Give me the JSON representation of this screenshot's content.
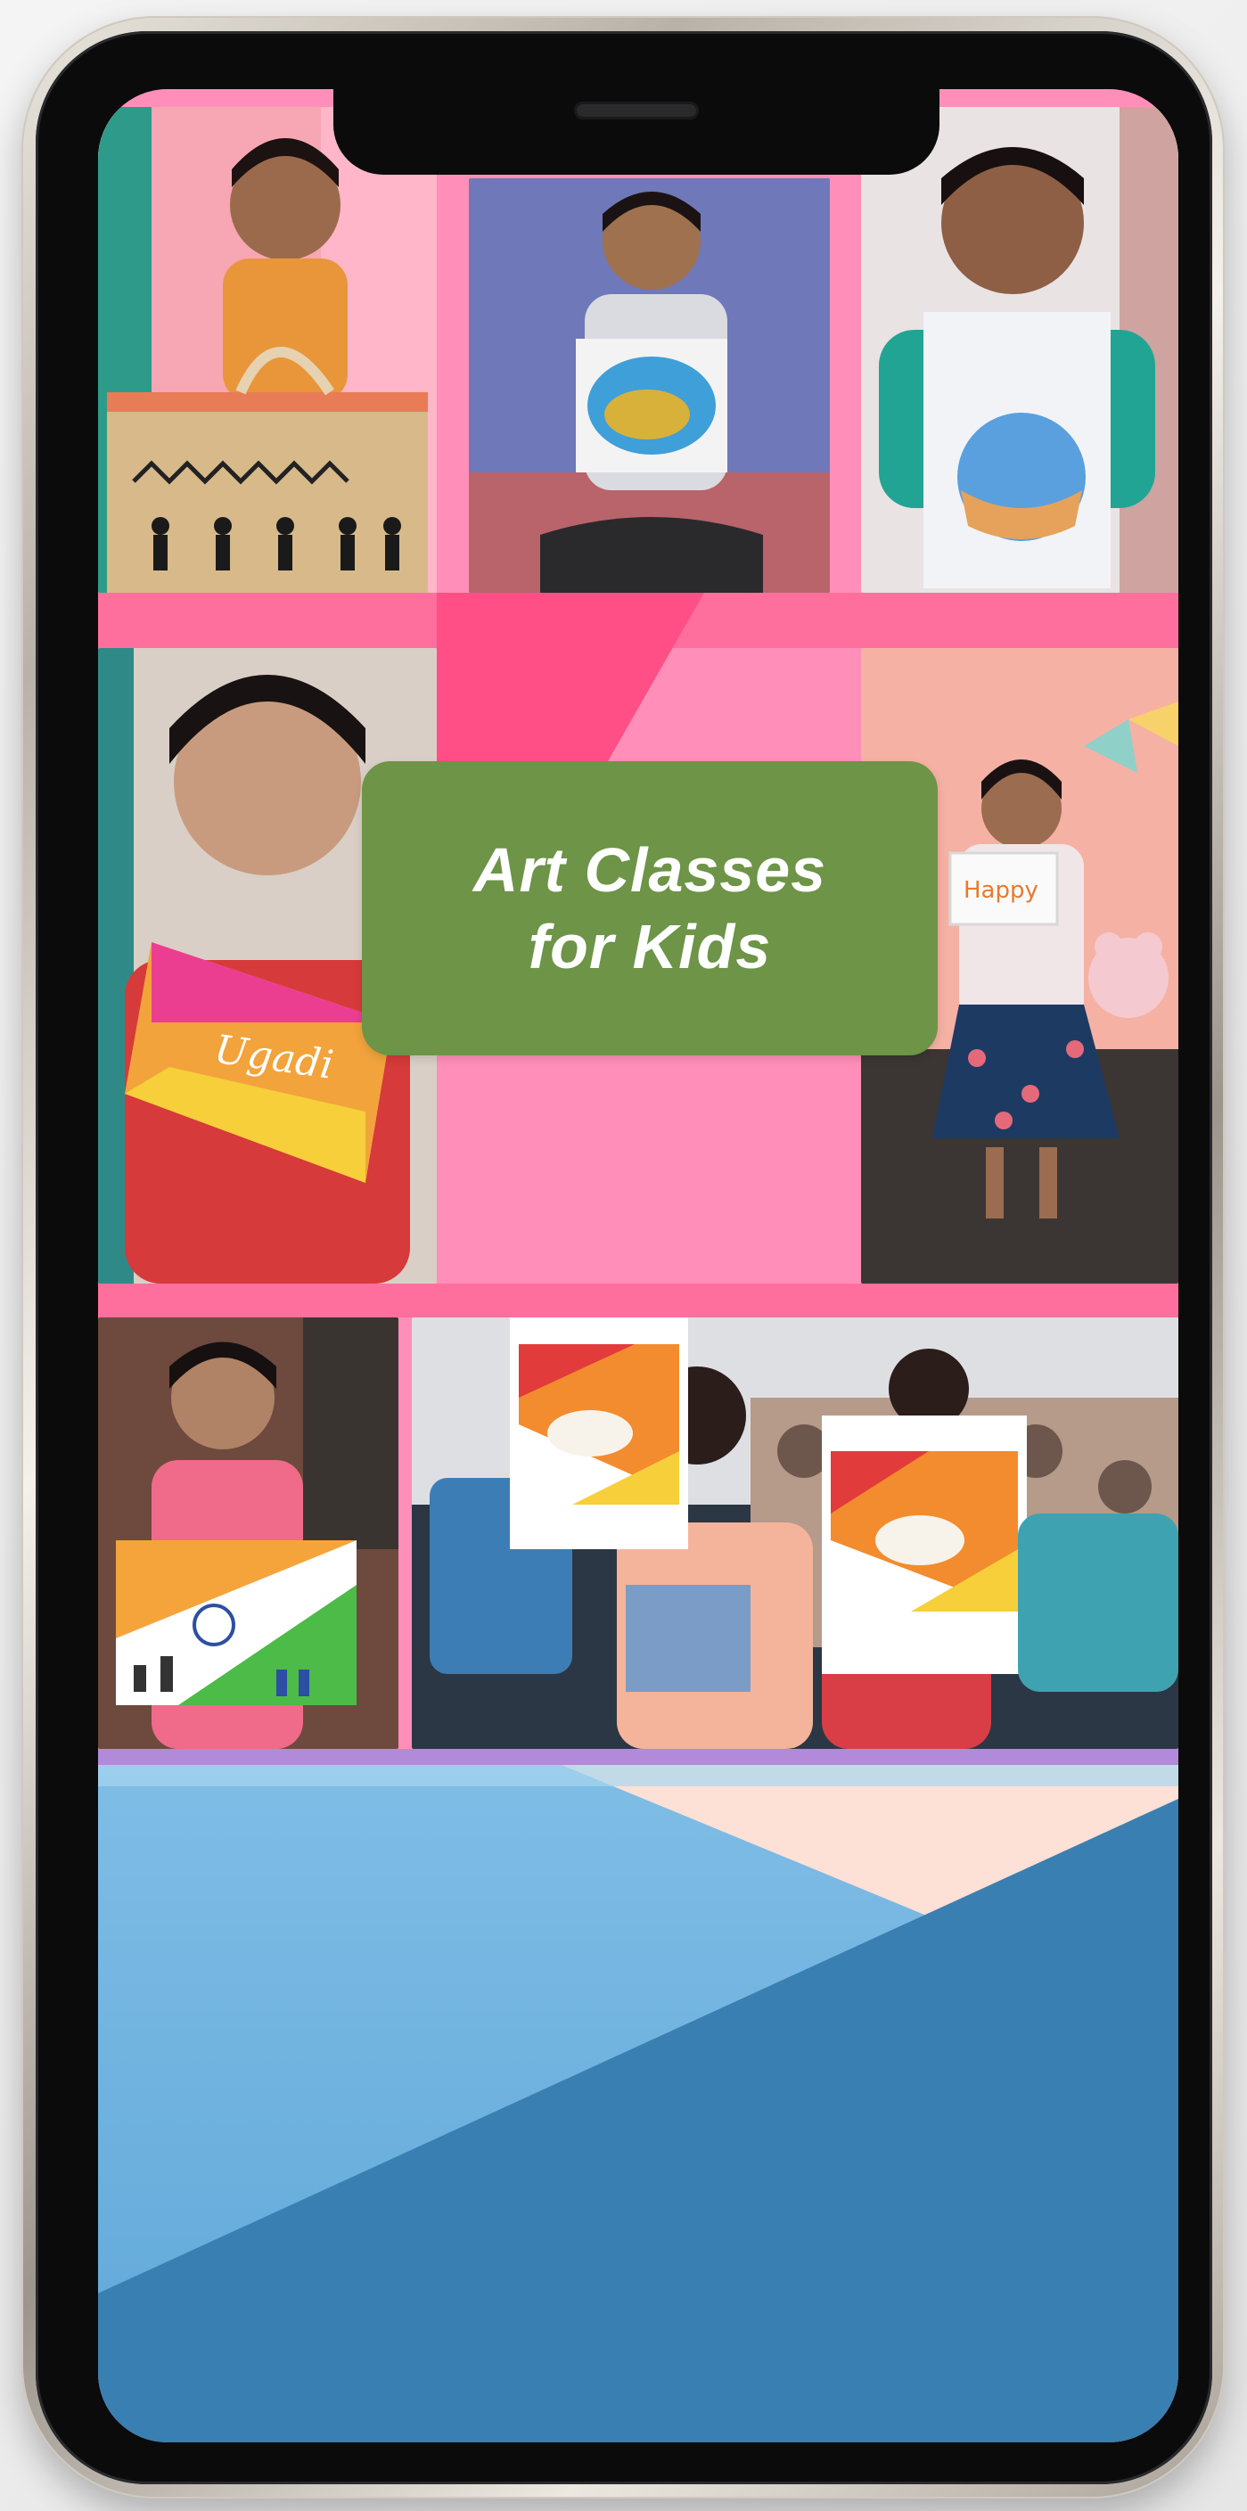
{
  "promo": {
    "title_line1": "Art Classes",
    "title_line2": "for Kids"
  },
  "colors": {
    "screen_pink": "#ff8fb8",
    "accent_pink": "#ff5f93",
    "title_card_green": "#6d9447",
    "title_text": "#ffffff",
    "bottom_light_blue": "#6fb6e2",
    "bottom_dark_blue": "#3a7fb1",
    "bottom_peach": "#fde0d6"
  },
  "photos": [
    {
      "name": "girl-with-painted-bag"
    },
    {
      "name": "boy-with-fish-drawing"
    },
    {
      "name": "boy-with-globe-drawing"
    },
    {
      "name": "boy-with-ugadi-drawing"
    },
    {
      "name": "girl-with-happy-card"
    },
    {
      "name": "girl-with-flag-drawing"
    },
    {
      "name": "kids-with-happy-ugadi-cards"
    }
  ]
}
